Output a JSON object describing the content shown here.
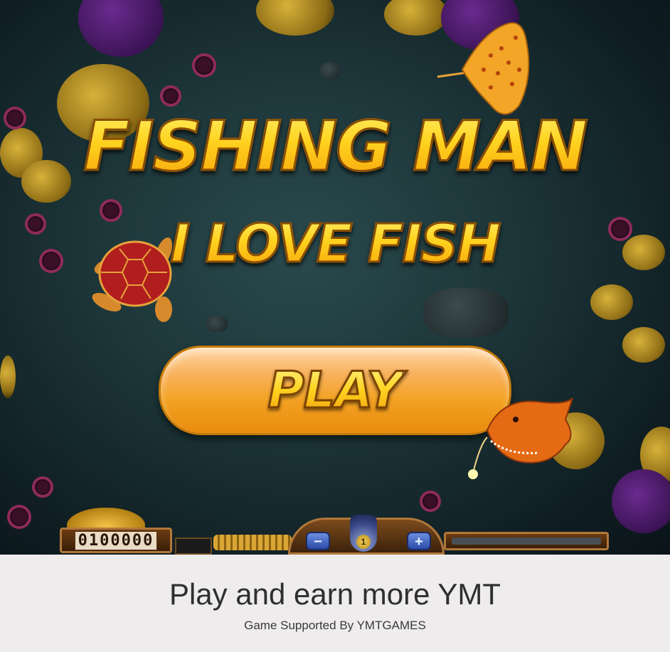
{
  "game": {
    "title_line1": "FISHING MAN",
    "title_line2": "I LOVE FISH",
    "play_label": "PLAY"
  },
  "hud": {
    "coin_counter": "0100000",
    "minus_label": "−",
    "plus_label": "+",
    "cannon_level": "1"
  },
  "footer": {
    "tagline": "Play and earn more YMT",
    "subline": "Game Supported By YMTGAMES"
  },
  "colors": {
    "title_gold": "#ffd21e",
    "play_button_orange": "#f3a324",
    "water": "#1d3639",
    "footer_bg": "#efeced"
  },
  "icons": [
    "stingray-icon",
    "sea-turtle-icon",
    "anglerfish-icon",
    "cannon-icon",
    "coin-pile-icon"
  ]
}
